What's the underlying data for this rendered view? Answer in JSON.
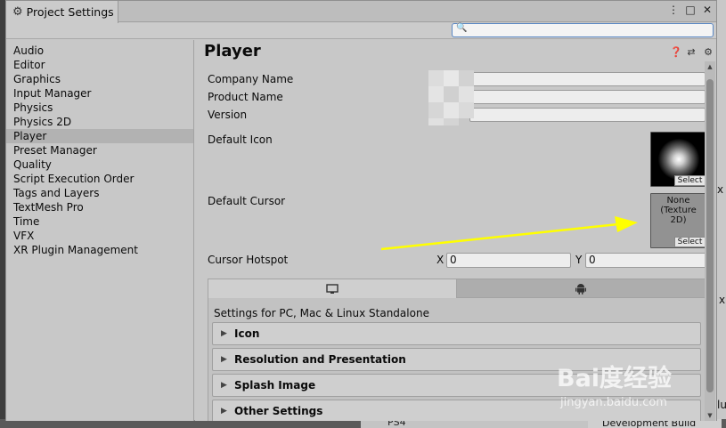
{
  "window": {
    "tab_title": "Project Settings",
    "controls": {
      "more": "⋮",
      "maximize": "□",
      "close": "✕"
    }
  },
  "search": {
    "value": "",
    "placeholder": ""
  },
  "sidebar": {
    "items": [
      {
        "label": "Audio"
      },
      {
        "label": "Editor"
      },
      {
        "label": "Graphics"
      },
      {
        "label": "Input Manager"
      },
      {
        "label": "Physics"
      },
      {
        "label": "Physics 2D"
      },
      {
        "label": "Player",
        "selected": true
      },
      {
        "label": "Preset Manager"
      },
      {
        "label": "Quality"
      },
      {
        "label": "Script Execution Order"
      },
      {
        "label": "Tags and Layers"
      },
      {
        "label": "TextMesh Pro"
      },
      {
        "label": "Time"
      },
      {
        "label": "VFX"
      },
      {
        "label": "XR Plugin Management"
      }
    ]
  },
  "main": {
    "title": "Player",
    "header_icons": [
      "help-icon",
      "preset-icon",
      "gear-icon"
    ],
    "fields": {
      "company_name": {
        "label": "Company Name",
        "value": ""
      },
      "product_name": {
        "label": "Product Name",
        "value": ""
      },
      "version": {
        "label": "Version",
        "value": ""
      }
    },
    "default_icon": {
      "label": "Default Icon",
      "select": "Select"
    },
    "default_cursor": {
      "label": "Default Cursor",
      "none_line1": "None",
      "none_line2": "(Texture 2D)",
      "select": "Select"
    },
    "cursor_hotspot": {
      "label": "Cursor Hotspot",
      "x_label": "X",
      "x_value": "0",
      "y_label": "Y",
      "y_value": "0"
    },
    "platform_tabs": [
      {
        "name": "pc",
        "icon": "monitor-icon",
        "selected": true
      },
      {
        "name": "android",
        "icon": "android-icon",
        "selected": false
      }
    ],
    "platform_caption": "Settings for PC, Mac & Linux Standalone",
    "sections": [
      {
        "title": "Icon"
      },
      {
        "title": "Resolution and Presentation"
      },
      {
        "title": "Splash Image"
      },
      {
        "title": "Other Settings"
      }
    ]
  },
  "background": {
    "development_build": "Development Build",
    "ps4": "PS4",
    "right_edge_chars": [
      "x",
      "x",
      "lu"
    ]
  },
  "annotation": {
    "arrow_color": "#ffff00"
  },
  "watermark": {
    "brand": "Bai度经验",
    "url": "jingyan.baidu.com"
  },
  "colors": {
    "window_bg": "#c8c8c8",
    "selected_row": "#b2b2b2",
    "search_border": "#5b88c4"
  }
}
